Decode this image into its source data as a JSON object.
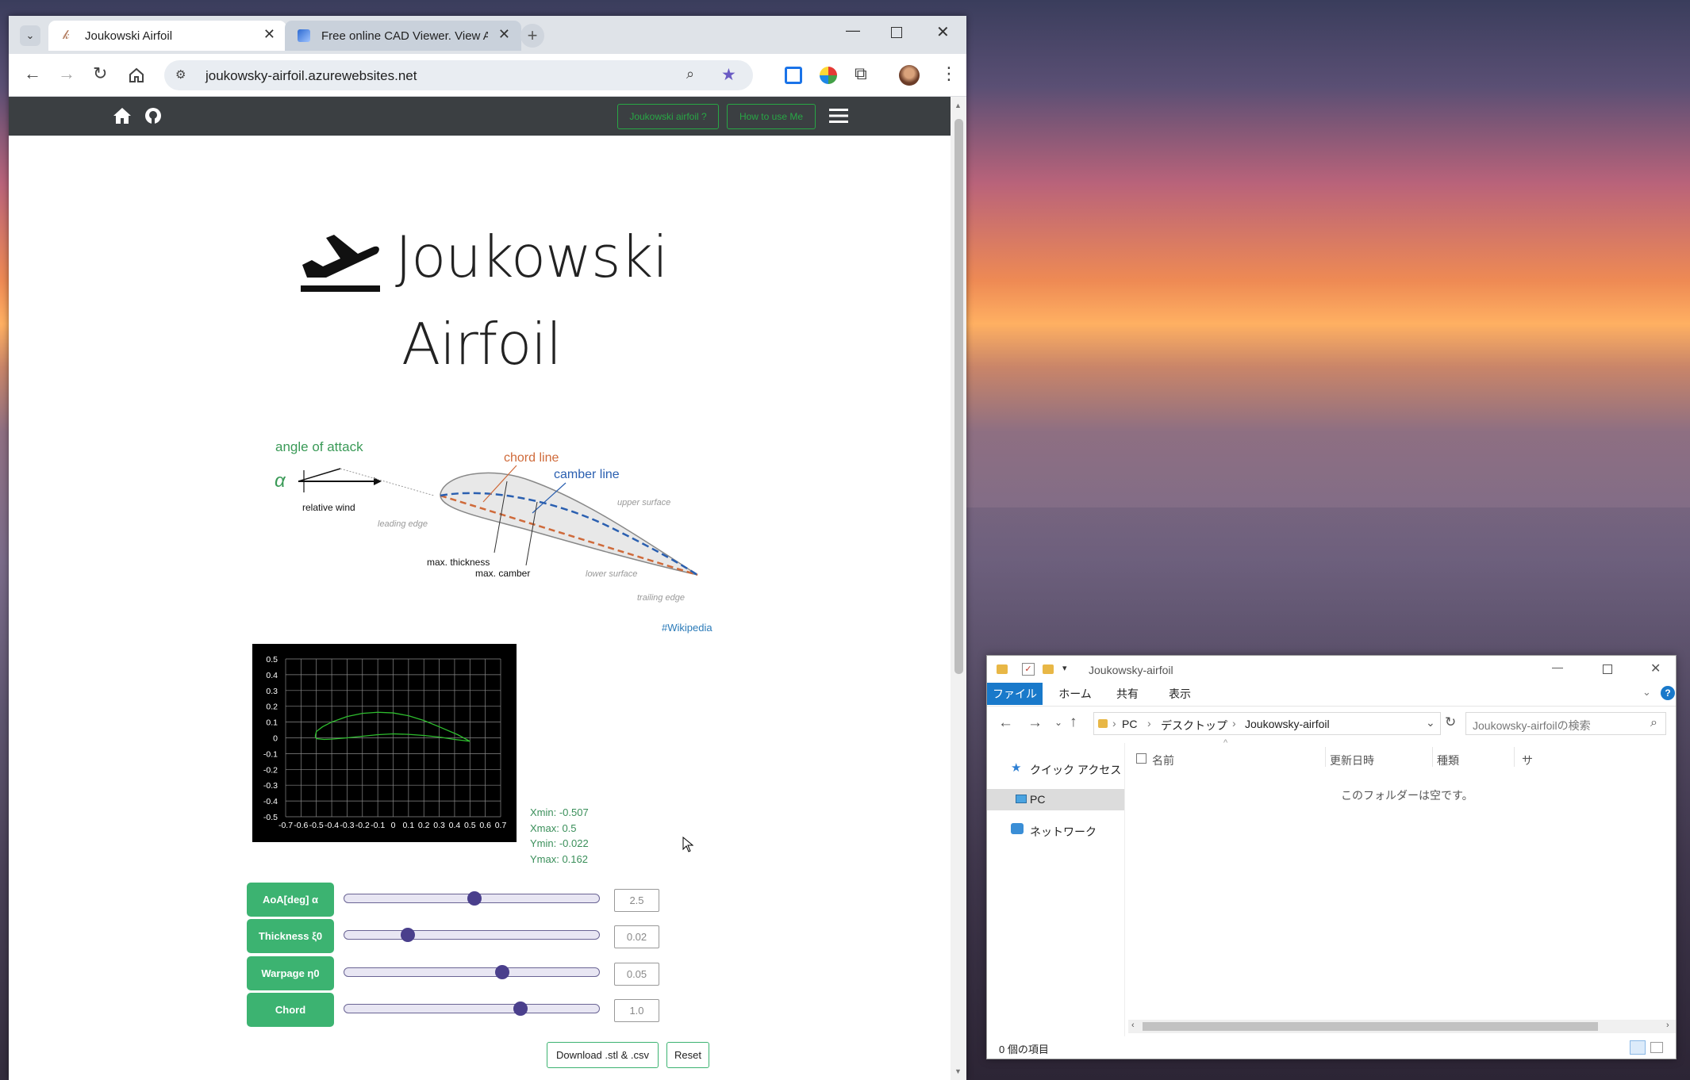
{
  "browser": {
    "tabs": [
      {
        "title": "Joukowski Airfoil",
        "favicon": "joukowski-favicon",
        "active": true
      },
      {
        "title": "Free online CAD Viewer. View A",
        "favicon": "cad-viewer-favicon",
        "active": false
      }
    ],
    "url": "joukowsky-airfoil.azurewebsites.net",
    "accent": "#28a745"
  },
  "site": {
    "nav_buttons": [
      "Joukowski airfoil ?",
      "How to use Me"
    ],
    "title_line1": "Joukowski",
    "title_line2": "Airfoil",
    "diagram": {
      "angle_of_attack": "angle of attack",
      "alpha": "α",
      "relative_wind": "relative wind",
      "chord_line": "chord line",
      "camber_line": "camber line",
      "upper_surface": "upper surface",
      "leading_edge": "leading edge",
      "max_thickness": "max. thickness",
      "max_camber": "max. camber",
      "lower_surface": "lower surface",
      "trailing_edge": "trailing edge"
    },
    "wiki_link": "#Wikipedia",
    "stats": {
      "xmin": "Xmin: -0.507",
      "xmax": "Xmax: 0.5",
      "ymin": "Ymin: -0.022",
      "ymax": "Ymax: 0.162"
    },
    "sliders": [
      {
        "label": "AoA[deg] α",
        "value": "2.5",
        "fraction": 0.51
      },
      {
        "label": "Thickness ξ0",
        "value": "0.02",
        "fraction": 0.25
      },
      {
        "label": "Warpage η0",
        "value": "0.05",
        "fraction": 0.62
      },
      {
        "label": "Chord",
        "value": "1.0",
        "fraction": 0.69
      }
    ],
    "download_label": "Download .stl & .csv",
    "reset_label": "Reset"
  },
  "chart_data": {
    "type": "line",
    "title": "",
    "xlabel": "",
    "ylabel": "",
    "xlim": [
      -0.7,
      0.7
    ],
    "ylim": [
      -0.5,
      0.5
    ],
    "x_ticks": [
      "-0.7",
      "-0.6",
      "-0.5",
      "-0.4",
      "-0.3",
      "-0.2",
      "-0.1",
      "0",
      "0.1",
      "0.2",
      "0.3",
      "0.4",
      "0.5",
      "0.6",
      "0.7"
    ],
    "y_ticks": [
      "0.5",
      "0.4",
      "0.3",
      "0.2",
      "0.1",
      "0",
      "-0.1",
      "-0.2",
      "-0.3",
      "-0.4",
      "-0.5"
    ],
    "grid": true,
    "background": "#000000",
    "line_color": "#2ebd2e",
    "series": [
      {
        "x": [
          0.5,
          0.42,
          0.3,
          0.2,
          0.1,
          0.0,
          -0.1,
          -0.2,
          -0.3,
          -0.4,
          -0.46,
          -0.5,
          -0.507,
          -0.5,
          -0.45,
          -0.4,
          -0.3,
          -0.2,
          -0.1,
          0.0,
          0.1,
          0.2,
          0.3,
          0.4,
          0.5
        ],
        "y": [
          -0.022,
          0.02,
          0.07,
          0.11,
          0.14,
          0.158,
          0.162,
          0.155,
          0.135,
          0.1,
          0.07,
          0.04,
          0.01,
          -0.005,
          -0.01,
          -0.008,
          0.0,
          0.01,
          0.02,
          0.025,
          0.022,
          0.015,
          0.005,
          -0.01,
          -0.022
        ]
      }
    ]
  },
  "explorer": {
    "title": "Joukowsky-airfoil",
    "ribbon_tabs": [
      "ファイル",
      "ホーム",
      "共有",
      "表示"
    ],
    "path": [
      "PC",
      "デスクトップ",
      "Joukowsky-airfoil"
    ],
    "search_placeholder": "Joukowsky-airfoilの検索",
    "nav_items": [
      "クイック アクセス",
      "PC",
      "ネットワーク"
    ],
    "columns": [
      "名前",
      "更新日時",
      "種類",
      "サ"
    ],
    "empty_message": "このフォルダーは空です。",
    "status": "0 個の項目",
    "ribbon_accent": "#1979ca"
  }
}
